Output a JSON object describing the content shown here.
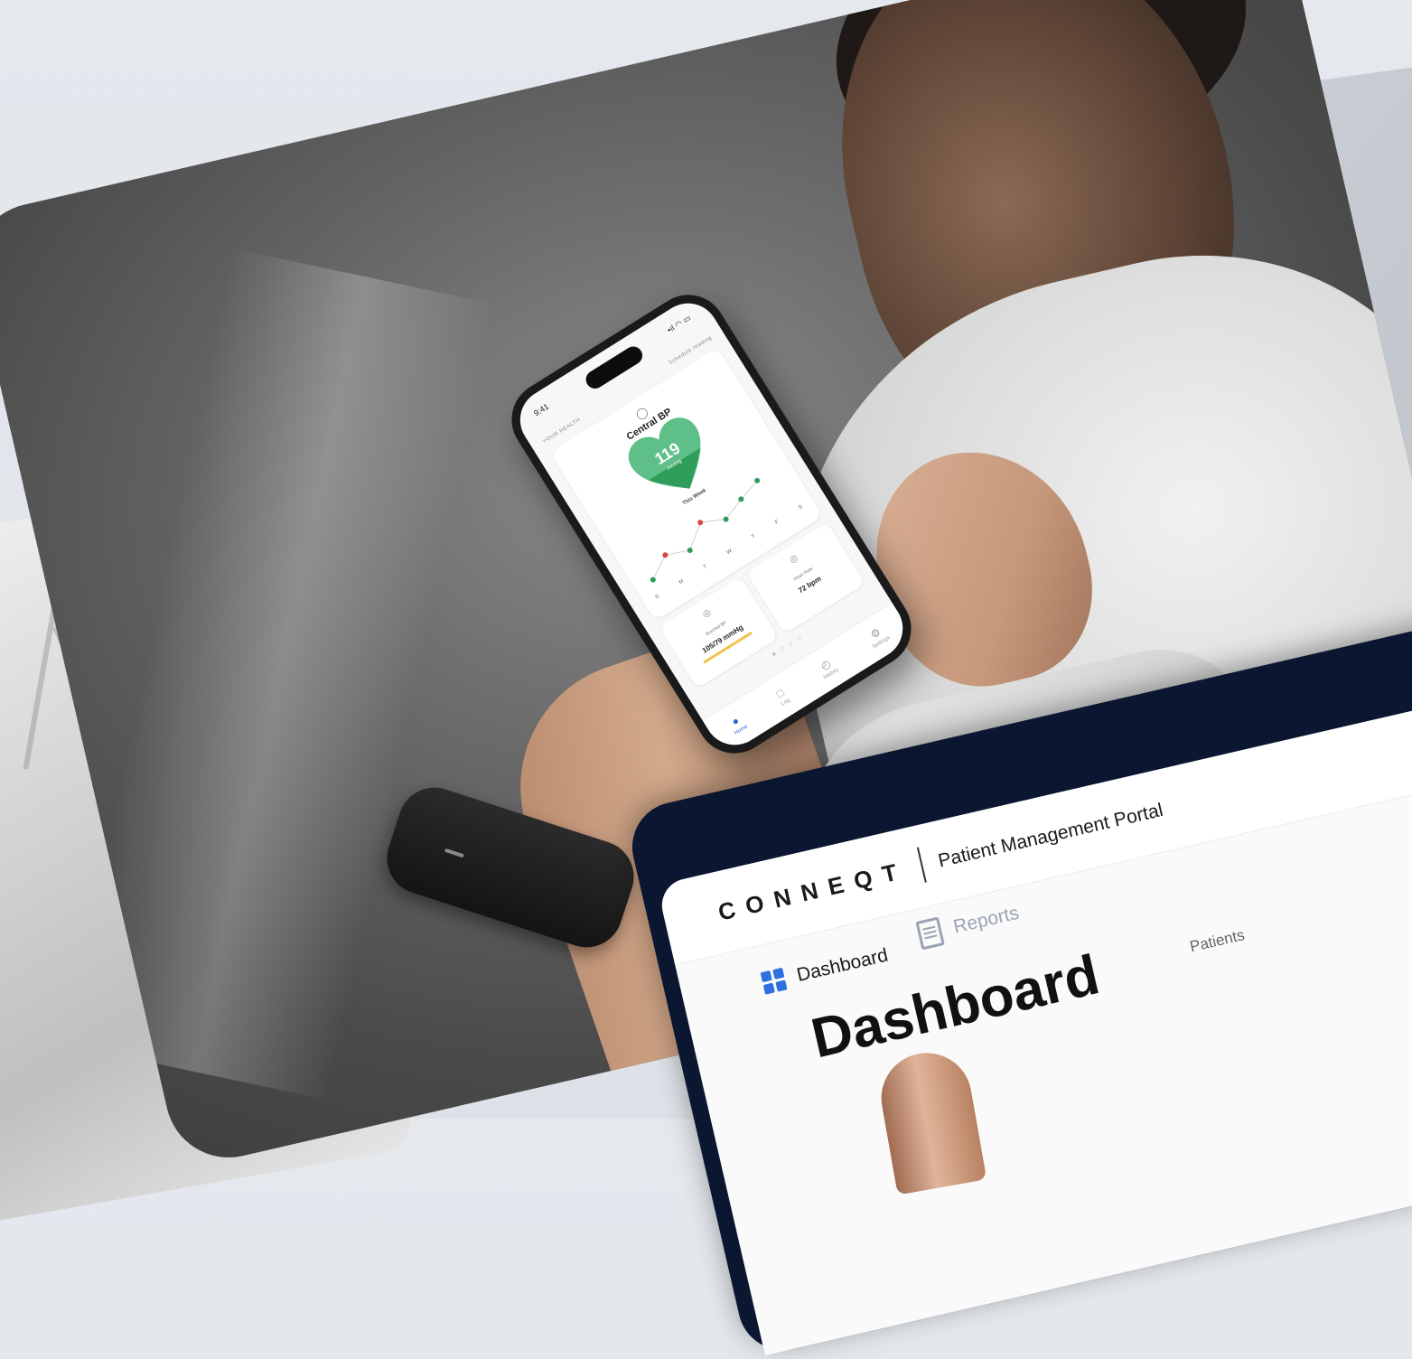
{
  "phone": {
    "status_time": "9:41",
    "status_icons": "•ıl ◠ ▭",
    "header_left": "YOUR HEALTH",
    "header_right": "Schedule reading",
    "card_title": "Central BP",
    "heart_value": "119",
    "heart_unit": "mmHg",
    "week_label": "This Week",
    "days": [
      "S",
      "M",
      "T",
      "W",
      "T",
      "F",
      "S"
    ],
    "mini_left": {
      "label": "Brachial BP",
      "value": "105/79 mmHg"
    },
    "mini_right": {
      "label": "Heart Rate",
      "value": "72 bpm"
    },
    "page_dots": "● ○ ○ ○",
    "tabs": [
      "Home",
      "Log",
      "History",
      "Settings"
    ],
    "colors": {
      "heart": "#3da66a",
      "dot_red": "#d84444",
      "dot_green": "#2f9e5a",
      "tab_active": "#2a6fd6"
    }
  },
  "tablet": {
    "brand": "CONNEQT",
    "portal_title": "Patient Management Portal",
    "nav_dashboard": "Dashboard",
    "nav_reports": "Reports",
    "page_heading": "Dashboard",
    "patients_label": "Patients",
    "colors": {
      "accent": "#2f6fe0",
      "frame": "#0b1730"
    }
  }
}
